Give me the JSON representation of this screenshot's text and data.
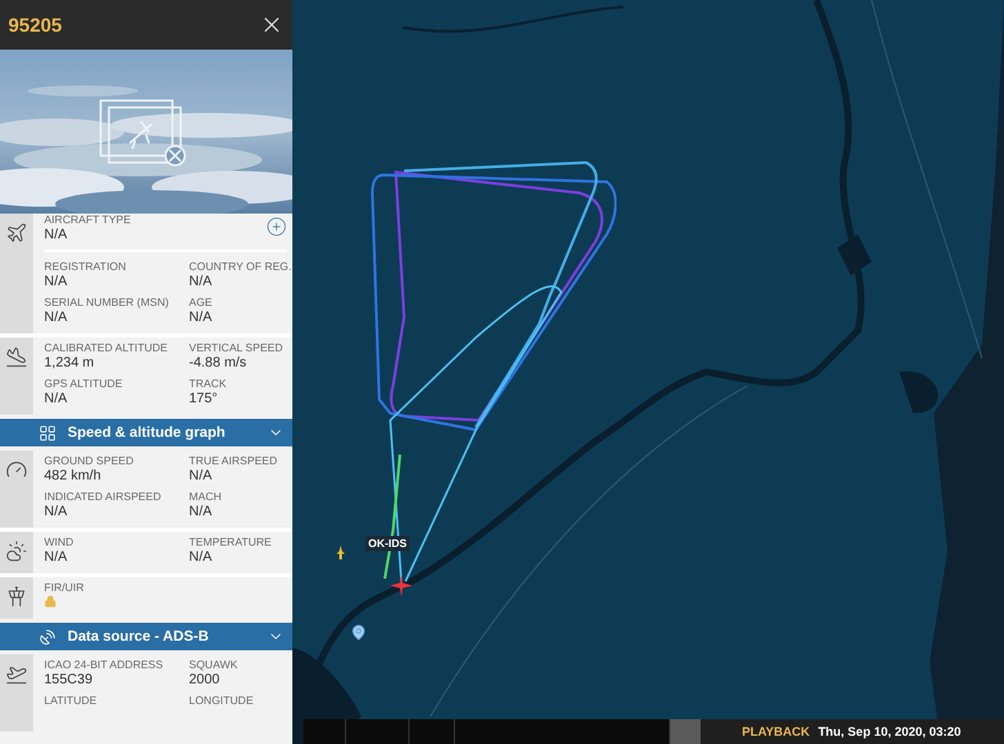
{
  "flight": {
    "callsign": "95205"
  },
  "panel": [
    {
      "kind": "group",
      "rows": [
        {
          "kind": "add",
          "fields": [
            {
              "label": "AIRCRAFT TYPE",
              "value": "N/A"
            }
          ]
        },
        {
          "kind": "pair",
          "fields": [
            {
              "label": "REGISTRATION",
              "value": "N/A"
            },
            {
              "label": "COUNTRY OF REG.",
              "value": "N/A"
            }
          ]
        },
        {
          "kind": "pair",
          "fields": [
            {
              "label": "SERIAL NUMBER (MSN)",
              "value": "N/A"
            },
            {
              "label": "AGE",
              "value": "N/A"
            }
          ]
        }
      ]
    },
    {
      "kind": "group",
      "rows": [
        {
          "kind": "pair",
          "fields": [
            {
              "label": "CALIBRATED ALTITUDE",
              "value": "1,234 m"
            },
            {
              "label": "VERTICAL SPEED",
              "value": "-4.88 m/s"
            }
          ]
        },
        {
          "kind": "pair",
          "fields": [
            {
              "label": "GPS ALTITUDE",
              "value": "N/A"
            },
            {
              "label": "TRACK",
              "value": "175°"
            }
          ]
        }
      ]
    },
    {
      "kind": "header",
      "title": "Speed & altitude graph",
      "expanded": false
    },
    {
      "kind": "group",
      "rows": [
        {
          "kind": "pair",
          "fields": [
            {
              "label": "GROUND SPEED",
              "value": "482 km/h"
            },
            {
              "label": "TRUE AIRSPEED",
              "value": "N/A"
            }
          ]
        },
        {
          "kind": "pair",
          "fields": [
            {
              "label": "INDICATED AIRSPEED",
              "value": "N/A"
            },
            {
              "label": "MACH",
              "value": "N/A"
            }
          ]
        }
      ]
    },
    {
      "kind": "group",
      "rows": [
        {
          "kind": "pair",
          "fields": [
            {
              "label": "WIND",
              "value": "N/A"
            },
            {
              "label": "TEMPERATURE",
              "value": "N/A"
            }
          ]
        }
      ]
    },
    {
      "kind": "group",
      "rows": [
        {
          "kind": "pair",
          "fields": [
            {
              "label": "FIR/UIR",
              "locked": true
            }
          ]
        }
      ]
    },
    {
      "kind": "header",
      "title": "Data source - ADS-B",
      "expanded": false
    },
    {
      "kind": "group",
      "rows": [
        {
          "kind": "pair",
          "fields": [
            {
              "label": "ICAO 24-BIT ADDRESS",
              "value": "155C39"
            },
            {
              "label": "SQUAWK",
              "value": "2000"
            }
          ]
        },
        {
          "kind": "pair",
          "fields": [
            {
              "label": "LATITUDE"
            },
            {
              "label": "LONGITUDE"
            }
          ]
        }
      ]
    }
  ],
  "map": {
    "aircraft_label": "OK-IDS"
  },
  "playback": {
    "label": "PLAYBACK",
    "time": "Thu, Sep 10, 2020, 03:20"
  }
}
